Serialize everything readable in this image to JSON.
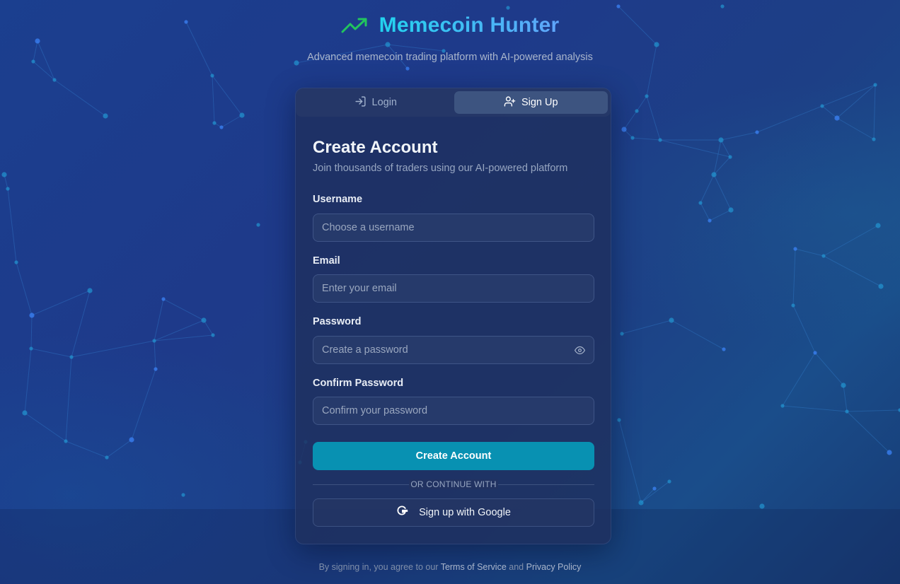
{
  "app": {
    "title": "Memecoin Hunter",
    "subtitle": "Advanced memecoin trading platform with AI-powered analysis",
    "logo_icon": "trending-up-icon"
  },
  "tabs": [
    {
      "label": "Login",
      "icon": "log-in-icon",
      "active": false
    },
    {
      "label": "Sign Up",
      "icon": "user-plus-icon",
      "active": true
    }
  ],
  "form": {
    "title": "Create Account",
    "description": "Join thousands of traders using our AI-powered platform",
    "fields": {
      "username": {
        "label": "Username",
        "placeholder": "Choose a username",
        "value": ""
      },
      "email": {
        "label": "Email",
        "placeholder": "Enter your email",
        "value": ""
      },
      "password": {
        "label": "Password",
        "placeholder": "Create a password",
        "value": ""
      },
      "confirm": {
        "label": "Confirm Password",
        "placeholder": "Confirm your password",
        "value": ""
      }
    },
    "submit_label": "Create Account",
    "divider_text": "OR CONTINUE WITH",
    "google_label": "Sign up with Google"
  },
  "footer": {
    "prefix": "By signing in, you agree to our",
    "terms": "Terms of Service",
    "and": "and",
    "privacy": "Privacy Policy"
  },
  "colors": {
    "accent": "#0891b2",
    "title_gradient_start": "#22d3ee",
    "title_gradient_end": "#60a5fa",
    "logo_green": "#22c55e"
  }
}
